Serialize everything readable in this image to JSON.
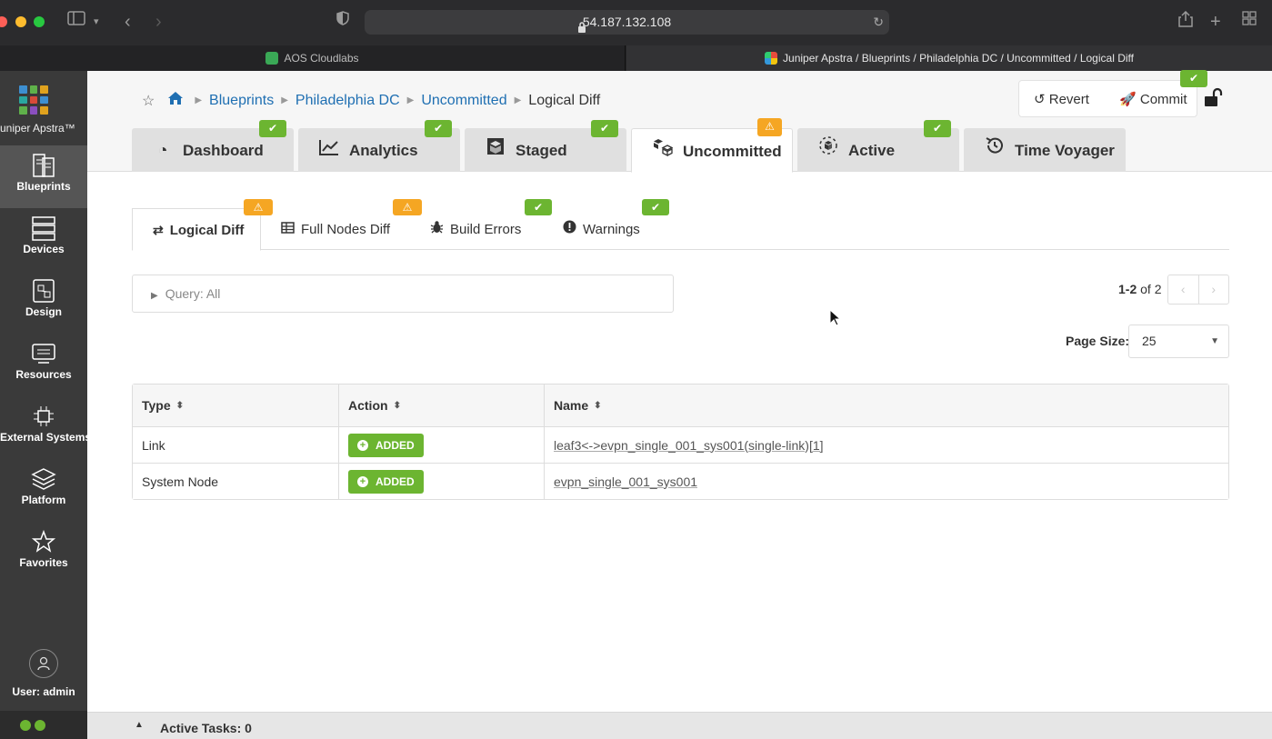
{
  "browser": {
    "url": "54.187.132.108",
    "tabs": [
      {
        "label": "AOS Cloudlabs"
      },
      {
        "label": "Juniper Apstra / Blueprints / Philadelphia DC / Uncommitted / Logical Diff"
      }
    ]
  },
  "nav": {
    "brand": "Juniper Apstra™",
    "items": [
      {
        "label": "Blueprints",
        "icon": "blueprints-icon"
      },
      {
        "label": "Devices",
        "icon": "devices-icon"
      },
      {
        "label": "Design",
        "icon": "design-icon"
      },
      {
        "label": "Resources",
        "icon": "resources-icon"
      },
      {
        "label": "External Systems",
        "icon": "external-systems-icon"
      },
      {
        "label": "Platform",
        "icon": "platform-icon"
      },
      {
        "label": "Favorites",
        "icon": "star-icon"
      }
    ],
    "user": "User: admin"
  },
  "breadcrumb": {
    "items": [
      "Blueprints",
      "Philadelphia DC",
      "Uncommitted"
    ],
    "current": "Logical Diff"
  },
  "actions": {
    "revert": "Revert",
    "commit": "Commit"
  },
  "main_tabs": [
    {
      "label": "Dashboard",
      "status": "ok"
    },
    {
      "label": "Analytics",
      "status": "ok"
    },
    {
      "label": "Staged",
      "status": "ok"
    },
    {
      "label": "Uncommitted",
      "status": "warning"
    },
    {
      "label": "Active",
      "status": "ok"
    },
    {
      "label": "Time Voyager",
      "status": ""
    }
  ],
  "sub_tabs": [
    {
      "label": "Logical Diff",
      "status": "warning"
    },
    {
      "label": "Full Nodes Diff",
      "status": "warning"
    },
    {
      "label": "Build Errors",
      "status": "ok"
    },
    {
      "label": "Warnings",
      "status": "ok"
    }
  ],
  "query": {
    "label": "Query: All"
  },
  "pager": {
    "range": "1-2",
    "of_label": "of",
    "total": "2"
  },
  "page_size": {
    "label": "Page Size:",
    "value": "25"
  },
  "table": {
    "columns": [
      "Type",
      "Action",
      "Name"
    ],
    "rows": [
      {
        "type": "Link",
        "action": "ADDED",
        "name": "leaf3<->evpn_single_001_sys001(single-link)[1]"
      },
      {
        "type": "System Node",
        "action": "ADDED",
        "name": "evpn_single_001_sys001"
      }
    ]
  },
  "bottom": {
    "active_tasks": "Active Tasks: 0"
  },
  "colors": {
    "ok": "#6cb531",
    "warning": "#f5a623",
    "link": "#1f6fb2",
    "nav_bg": "#3a3a3a"
  }
}
